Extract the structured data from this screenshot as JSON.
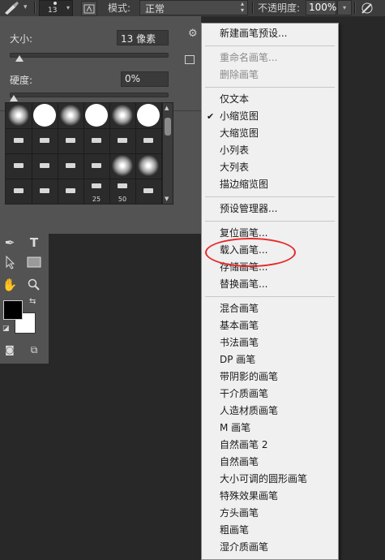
{
  "toolbar": {
    "brush_size": "13",
    "mode_label": "模式:",
    "mode_value": "正常",
    "opacity_label": "不透明度:",
    "opacity_value": "100%",
    "colors": {
      "bar": "#3c3c3c"
    }
  },
  "panel": {
    "size_label": "大小:",
    "size_value": "13 像素",
    "size_slider": 0.06,
    "hardness_label": "硬度:",
    "hardness_value": "0%",
    "hardness_slider": 0.0,
    "presets": [
      {
        "kind": "soft"
      },
      {
        "kind": "hard"
      },
      {
        "kind": "soft"
      },
      {
        "kind": "hard"
      },
      {
        "kind": "soft"
      },
      {
        "kind": "hard"
      },
      {
        "kind": "tip"
      },
      {
        "kind": "tip"
      },
      {
        "kind": "tip"
      },
      {
        "kind": "tip"
      },
      {
        "kind": "tip"
      },
      {
        "kind": "tip"
      },
      {
        "kind": "tip"
      },
      {
        "kind": "tip"
      },
      {
        "kind": "tip"
      },
      {
        "kind": "tip"
      },
      {
        "kind": "soft"
      },
      {
        "kind": "soft"
      },
      {
        "kind": "tip"
      },
      {
        "kind": "tip"
      },
      {
        "kind": "tip"
      },
      {
        "kind": "tip",
        "size": "25"
      },
      {
        "kind": "tip",
        "size": "50"
      },
      {
        "kind": "tip"
      }
    ]
  },
  "tools": {
    "items": [
      {
        "name": "pen-tool-icon",
        "glyph": "✒"
      },
      {
        "name": "type-tool-icon",
        "glyph": "T"
      },
      {
        "name": "path-select-icon",
        "glyph": "➤"
      },
      {
        "name": "rectangle-tool-icon",
        "glyph": "▭"
      },
      {
        "name": "hand-tool-icon",
        "glyph": "✋"
      },
      {
        "name": "zoom-tool-icon",
        "glyph": "🔍"
      }
    ],
    "foreground_color": "#000000",
    "background_color": "#ffffff"
  },
  "menu": {
    "items": [
      {
        "label": "新建画笔预设...",
        "disabled": false
      },
      {
        "sep": true
      },
      {
        "label": "重命名画笔...",
        "disabled": true
      },
      {
        "label": "删除画笔",
        "disabled": true
      },
      {
        "sep": true
      },
      {
        "label": "仅文本",
        "disabled": false
      },
      {
        "label": "小缩览图",
        "disabled": false,
        "checked": true
      },
      {
        "label": "大缩览图",
        "disabled": false
      },
      {
        "label": "小列表",
        "disabled": false
      },
      {
        "label": "大列表",
        "disabled": false
      },
      {
        "label": "描边缩览图",
        "disabled": false
      },
      {
        "sep": true
      },
      {
        "label": "预设管理器...",
        "disabled": false
      },
      {
        "sep": true
      },
      {
        "label": "复位画笔...",
        "disabled": false
      },
      {
        "label": "载入画笔...",
        "disabled": false,
        "highlighted": true
      },
      {
        "label": "存储画笔...",
        "disabled": false
      },
      {
        "label": "替换画笔...",
        "disabled": false
      },
      {
        "sep": true
      },
      {
        "label": "混合画笔",
        "disabled": false
      },
      {
        "label": "基本画笔",
        "disabled": false
      },
      {
        "label": "书法画笔",
        "disabled": false
      },
      {
        "label": "DP 画笔",
        "disabled": false
      },
      {
        "label": "带阴影的画笔",
        "disabled": false
      },
      {
        "label": "干介质画笔",
        "disabled": false
      },
      {
        "label": "人造材质画笔",
        "disabled": false
      },
      {
        "label": "M 画笔",
        "disabled": false
      },
      {
        "label": "自然画笔 2",
        "disabled": false
      },
      {
        "label": "自然画笔",
        "disabled": false
      },
      {
        "label": "大小可调的圆形画笔",
        "disabled": false
      },
      {
        "label": "特殊效果画笔",
        "disabled": false
      },
      {
        "label": "方头画笔",
        "disabled": false
      },
      {
        "label": "粗画笔",
        "disabled": false
      },
      {
        "label": "湿介质画笔",
        "disabled": false
      }
    ]
  },
  "annotation": {
    "color": "#e82a2a"
  }
}
